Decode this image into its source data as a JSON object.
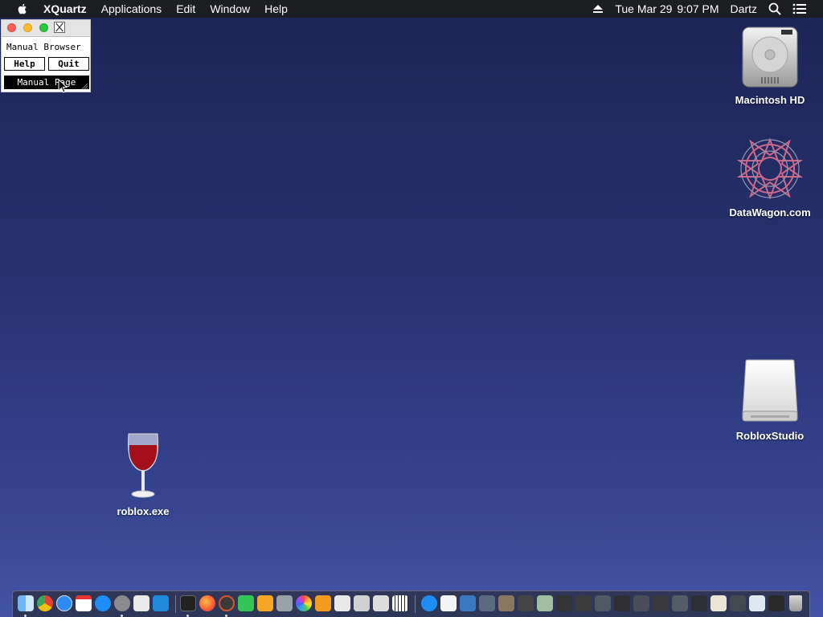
{
  "menubar": {
    "apple_icon": "apple-logo-icon",
    "app_name": "XQuartz",
    "items": [
      "Applications",
      "Edit",
      "Window",
      "Help"
    ],
    "date": "Tue Mar 29",
    "time": "9:07 PM",
    "user": "Dartz"
  },
  "xman_window": {
    "heading": "Manual Browser",
    "help_label": "Help",
    "quit_label": "Quit",
    "manual_page_label": "Manual Page"
  },
  "desktop": {
    "icons": {
      "macintosh_hd": "Macintosh HD",
      "datawagon": "DataWagon.com",
      "roblox_studio": "RobloxStudio",
      "roblox_exe": "roblox.exe"
    }
  },
  "colors": {
    "desktop_top": "#1c2455",
    "desktop_bottom": "#4353a4",
    "menubar": "#1d1e22",
    "close": "#fd5f57",
    "minimize": "#febc2e",
    "zoom": "#2ac840"
  },
  "dock": {
    "apps": [
      "finder-icon",
      "chrome-icon",
      "safari-icon",
      "app-store-icon",
      "system-preferences-icon",
      "roblox-icon",
      "roblox-studio-icon",
      "terminal-icon",
      "firefox-icon",
      "xquartz-icon",
      "facetime-icon",
      "home-icon",
      "automator-icon",
      "photos-icon",
      "books-icon",
      "textedit-icon",
      "wine-icon",
      "script-editor-icon",
      "piano-icon",
      "app-store-icon",
      "document-icon",
      "window-thumbnail-icon"
    ]
  }
}
